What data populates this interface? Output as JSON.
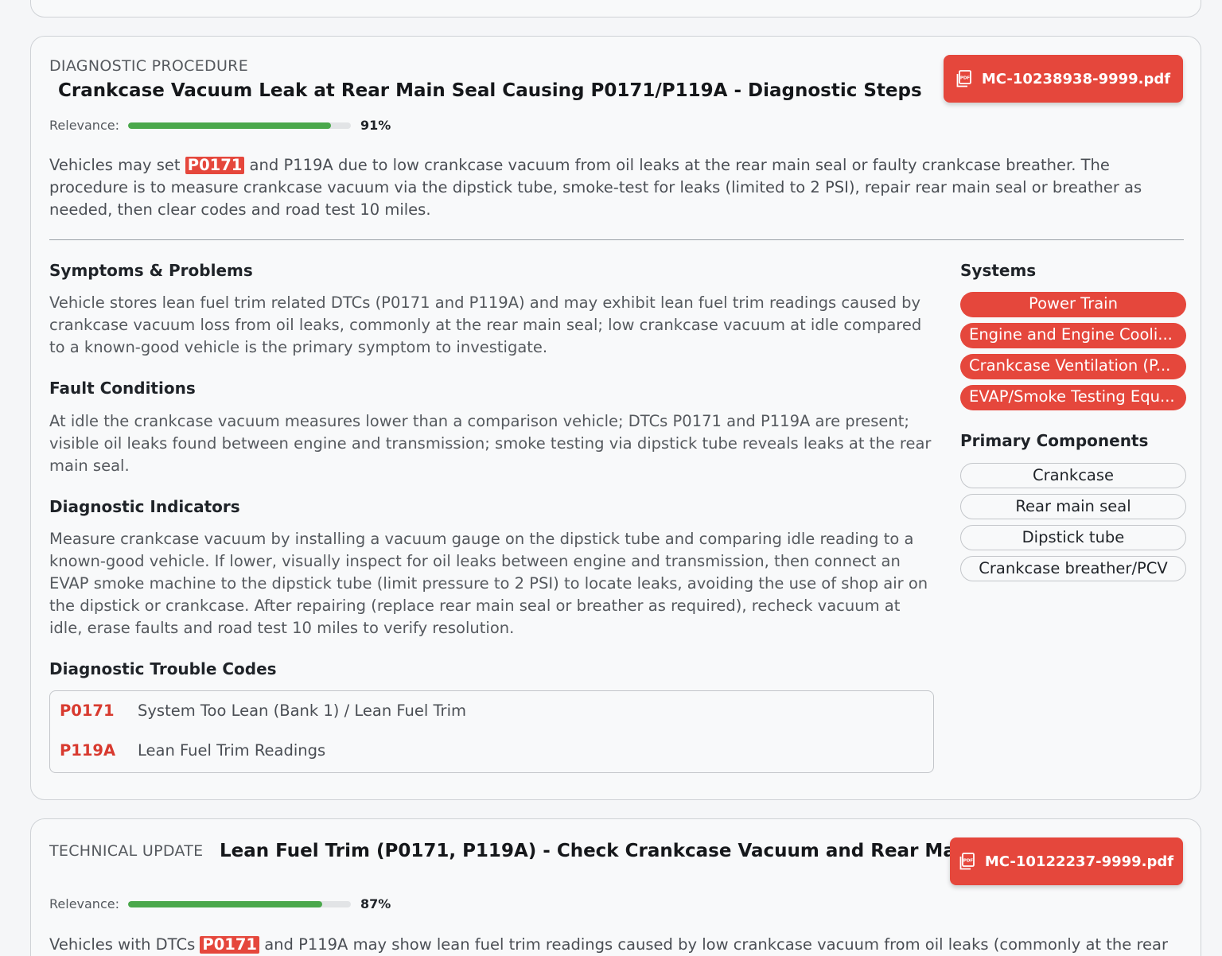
{
  "documents": [
    {
      "type_label": "DIAGNOSTIC PROCEDURE",
      "title": "Crankcase Vacuum Leak at Rear Main Seal Causing P0171/P119A - Diagnostic Steps",
      "pdf_label": "MC-10238938-9999.pdf",
      "relevance_label": "Relevance:",
      "relevance_value": "91%",
      "relevance_fraction": 0.91,
      "summary_before": "Vehicles may set ",
      "summary_code": "P0171",
      "summary_after": " and P119A due to low crankcase vacuum from oil leaks at the rear main seal or faulty crankcase breather. The procedure is to measure crankcase vacuum via the dipstick tube, smoke-test for leaks (limited to 2 PSI), repair rear main seal or breather as needed, then clear codes and road test 10 miles.",
      "sections": [
        {
          "heading": "Symptoms & Problems",
          "body": "Vehicle stores lean fuel trim related DTCs (P0171 and P119A) and may exhibit lean fuel trim readings caused by crankcase vacuum loss from oil leaks, commonly at the rear main seal; low crankcase vacuum at idle compared to a known-good vehicle is the primary symptom to investigate."
        },
        {
          "heading": "Fault Conditions",
          "body": "At idle the crankcase vacuum measures lower than a comparison vehicle; DTCs P0171 and P119A are present; visible oil leaks found between engine and transmission; smoke testing via dipstick tube reveals leaks at the rear main seal."
        },
        {
          "heading": "Diagnostic Indicators",
          "body": "Measure crankcase vacuum by installing a vacuum gauge on the dipstick tube and comparing idle reading to a known-good vehicle. If lower, visually inspect for oil leaks between engine and transmission, then connect an EVAP smoke machine to the dipstick tube (limit pressure to 2 PSI) to locate leaks, avoiding the use of shop air on the dipstick or crankcase. After repairing (replace rear main seal or breather as required), recheck vacuum at idle, erase faults and road test 10 miles to verify resolution."
        }
      ],
      "dtc_heading": "Diagnostic Trouble Codes",
      "dtcs": [
        {
          "code": "P0171",
          "description": "System Too Lean (Bank 1) / Lean Fuel Trim"
        },
        {
          "code": "P119A",
          "description": "Lean Fuel Trim Readings"
        }
      ],
      "systems_heading": "Systems",
      "systems": [
        "Power Train",
        "Engine and Engine Cooli...",
        "Crankcase Ventilation (P...",
        "EVAP/Smoke Testing Equ..."
      ],
      "components_heading": "Primary Components",
      "components": [
        "Crankcase",
        "Rear main seal",
        "Dipstick tube",
        "Crankcase breather/PCV"
      ]
    },
    {
      "type_label": "TECHNICAL UPDATE",
      "title": "Lean Fuel Trim (P0171, P119A) - Check Crankcase Vacuum and Rear Main Seal",
      "pdf_label": "MC-10122237-9999.pdf",
      "relevance_label": "Relevance:",
      "relevance_value": "87%",
      "relevance_fraction": 0.87,
      "summary_before": "Vehicles with DTCs ",
      "summary_code": "P0171",
      "summary_after": " and P119A may show lean fuel trim readings caused by low crankcase vacuum from oil leaks (commonly at the rear"
    }
  ],
  "colors": {
    "accent_red": "#e5473c",
    "relevance_green": "#4aa84b",
    "dtc_code_red": "#d83a2f"
  },
  "icons": {
    "pdf_button_icon": "pdf-file-icon"
  }
}
